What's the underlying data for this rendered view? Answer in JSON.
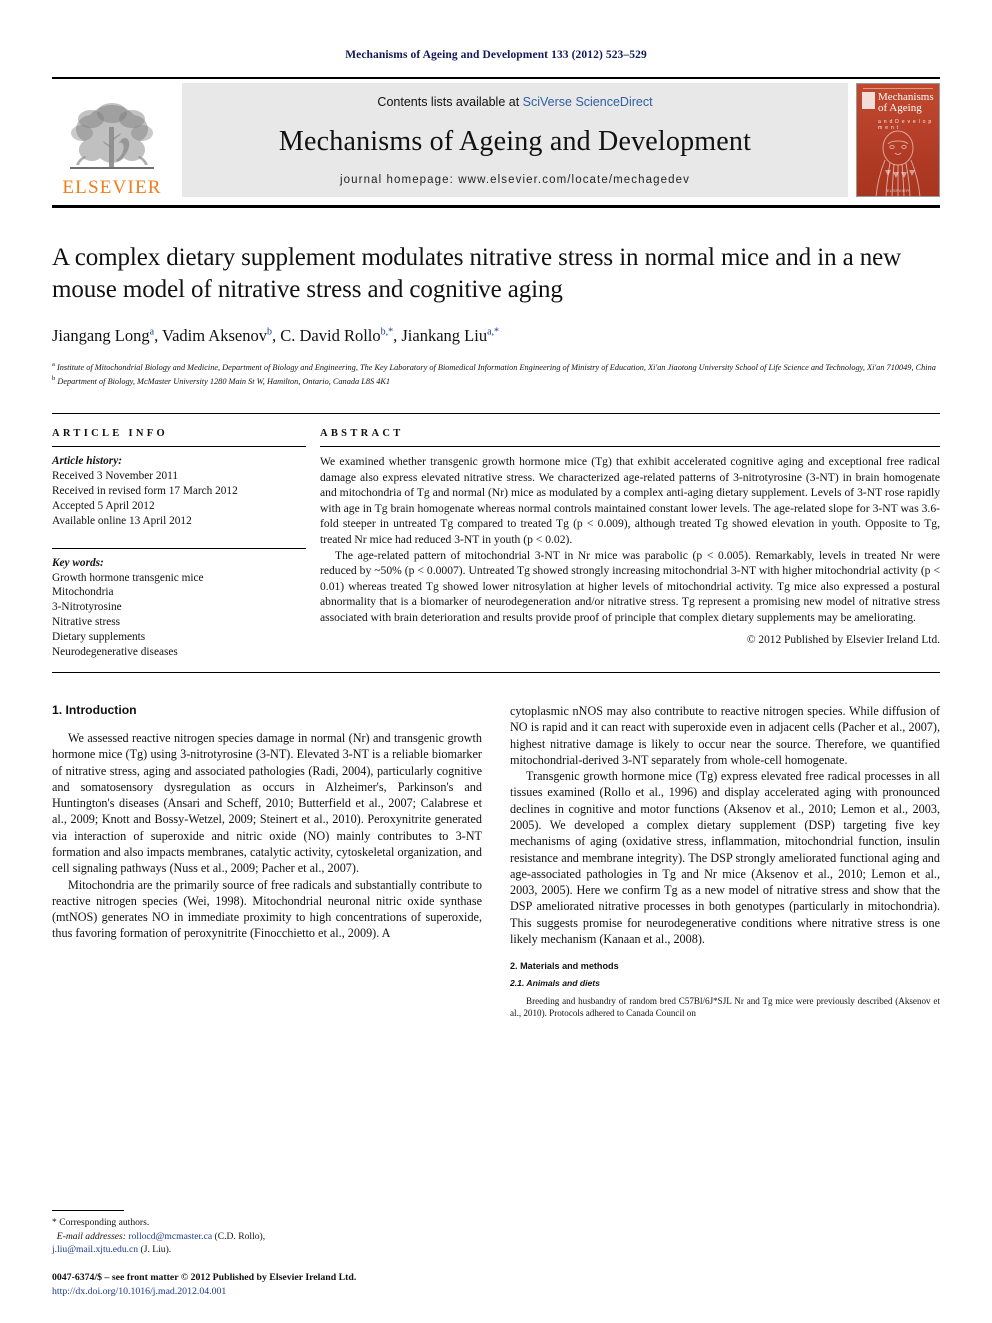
{
  "running_head": "Mechanisms of Ageing and Development 133 (2012) 523–529",
  "masthead": {
    "publisher_logo_text": "ELSEVIER",
    "contents_prefix": "Contents lists available at ",
    "contents_link": "SciVerse ScienceDirect",
    "journal_title": "Mechanisms of Ageing and Development",
    "homepage": "journal homepage: www.elsevier.com/locate/mechagedev",
    "cover": {
      "title_line1": "Mechanisms",
      "title_line2": "of Ageing",
      "subtitle": "a n d  D e v e l o p m e n t",
      "footer": "ELSEVIER"
    }
  },
  "article": {
    "title": "A complex dietary supplement modulates nitrative stress in normal mice and in a new mouse model of nitrative stress and cognitive aging",
    "authors": [
      {
        "name": "Jiangang Long",
        "sup": "a"
      },
      {
        "name": "Vadim Aksenov",
        "sup": "b"
      },
      {
        "name": "C. David Rollo",
        "sup": "b,*"
      },
      {
        "name": "Jiankang Liu",
        "sup": "a,*"
      }
    ],
    "affiliations": [
      {
        "label": "a",
        "text": "Institute of Mitochondrial Biology and Medicine, Department of Biology and Engineering, The Key Laboratory of Biomedical Information Engineering of Ministry of Education, Xi'an Jiaotong University School of Life Science and Technology, Xi'an 710049, China"
      },
      {
        "label": "b",
        "text": "Department of Biology, McMaster University 1280 Main St W, Hamilton, Ontario, Canada L8S 4K1"
      }
    ]
  },
  "article_info": {
    "heading": "ARTICLE INFO",
    "history_label": "Article history:",
    "history": [
      "Received 3 November 2011",
      "Received in revised form 17 March 2012",
      "Accepted 5 April 2012",
      "Available online 13 April 2012"
    ],
    "keywords_label": "Key words:",
    "keywords": [
      "Growth hormone transgenic mice",
      "Mitochondria",
      "3-Nitrotyrosine",
      "Nitrative stress",
      "Dietary supplements",
      "Neurodegenerative diseases"
    ]
  },
  "abstract": {
    "heading": "ABSTRACT",
    "paragraphs": [
      "We examined whether transgenic growth hormone mice (Tg) that exhibit accelerated cognitive aging and exceptional free radical damage also express elevated nitrative stress. We characterized age-related patterns of 3-nitrotyrosine (3-NT) in brain homogenate and mitochondria of Tg and normal (Nr) mice as modulated by a complex anti-aging dietary supplement. Levels of 3-NT rose rapidly with age in Tg brain homogenate whereas normal controls maintained constant lower levels. The age-related slope for 3-NT was 3.6-fold steeper in untreated Tg compared to treated Tg (p < 0.009), although treated Tg showed elevation in youth. Opposite to Tg, treated Nr mice had reduced 3-NT in youth (p < 0.02).",
      "The age-related pattern of mitochondrial 3-NT in Nr mice was parabolic (p < 0.005). Remarkably, levels in treated Nr were reduced by ~50% (p < 0.0007). Untreated Tg showed strongly increasing mitochondrial 3-NT with higher mitochondrial activity (p < 0.01) whereas treated Tg showed lower nitrosylation at higher levels of mitochondrial activity. Tg mice also expressed a postural abnormality that is a biomarker of neurodegeneration and/or nitrative stress. Tg represent a promising new model of nitrative stress associated with brain deterioration and results provide proof of principle that complex dietary supplements may be ameliorating."
    ],
    "copyright": "© 2012 Published by Elsevier Ireland Ltd."
  },
  "body": {
    "intro_heading": "1. Introduction",
    "left_paragraphs": [
      "We assessed reactive nitrogen species damage in normal (Nr) and transgenic growth hormone mice (Tg) using 3-nitrotyrosine (3-NT). Elevated 3-NT is a reliable biomarker of nitrative stress, aging and associated pathologies (Radi, 2004), particularly cognitive and somatosensory dysregulation as occurs in Alzheimer's, Parkinson's and Huntington's diseases (Ansari and Scheff, 2010; Butterfield et al., 2007; Calabrese et al., 2009; Knott and Bossy-Wetzel, 2009; Steinert et al., 2010). Peroxynitrite generated via interaction of superoxide and nitric oxide (NO) mainly contributes to 3-NT formation and also impacts membranes, catalytic activity, cytoskeletal organization, and cell signaling pathways (Nuss et al., 2009; Pacher et al., 2007).",
      "Mitochondria are the primarily source of free radicals and substantially contribute to reactive nitrogen species (Wei, 1998). Mitochondrial neuronal nitric oxide synthase (mtNOS) generates NO in immediate proximity to high concentrations of superoxide, thus favoring formation of peroxynitrite (Finocchietto et al., 2009). A"
    ],
    "right_paragraphs": [
      "cytoplasmic nNOS may also contribute to reactive nitrogen species. While diffusion of NO is rapid and it can react with superoxide even in adjacent cells (Pacher et al., 2007), highest nitrative damage is likely to occur near the source. Therefore, we quantified mitochondrial-derived 3-NT separately from whole-cell homogenate.",
      "Transgenic growth hormone mice (Tg) express elevated free radical processes in all tissues examined (Rollo et al., 1996) and display accelerated aging with pronounced declines in cognitive and motor functions (Aksenov et al., 2010; Lemon et al., 2003, 2005). We developed a complex dietary supplement (DSP) targeting five key mechanisms of aging (oxidative stress, inflammation, mitochondrial function, insulin resistance and membrane integrity). The DSP strongly ameliorated functional aging and age-associated pathologies in Tg and Nr mice (Aksenov et al., 2010; Lemon et al., 2003, 2005). Here we confirm Tg as a new model of nitrative stress and show that the DSP ameliorated nitrative processes in both genotypes (particularly in mitochondria). This suggests promise for neurodegenerative conditions where nitrative stress is one likely mechanism (Kanaan et al., 2008)."
    ],
    "methods_heading": "2. Materials and methods",
    "methods_sub_heading": "2.1. Animals and diets",
    "methods_paragraph": "Breeding and husbandry of random bred C57Bl/6J*SJL Nr and Tg mice were previously described (Aksenov et al., 2010). Protocols adhered to Canada Council on"
  },
  "footnotes": {
    "corresponding": "* Corresponding authors.",
    "email_label": "E-mail addresses:",
    "email1": "rollocd@mcmaster.ca",
    "email1_who": "(C.D. Rollo),",
    "email2": "j.liu@mail.xjtu.edu.cn",
    "email2_who": "(J. Liu).",
    "front_matter": "0047-6374/$ – see front matter © 2012 Published by Elsevier Ireland Ltd.",
    "doi": "http://dx.doi.org/10.1016/j.mad.2012.04.001"
  }
}
